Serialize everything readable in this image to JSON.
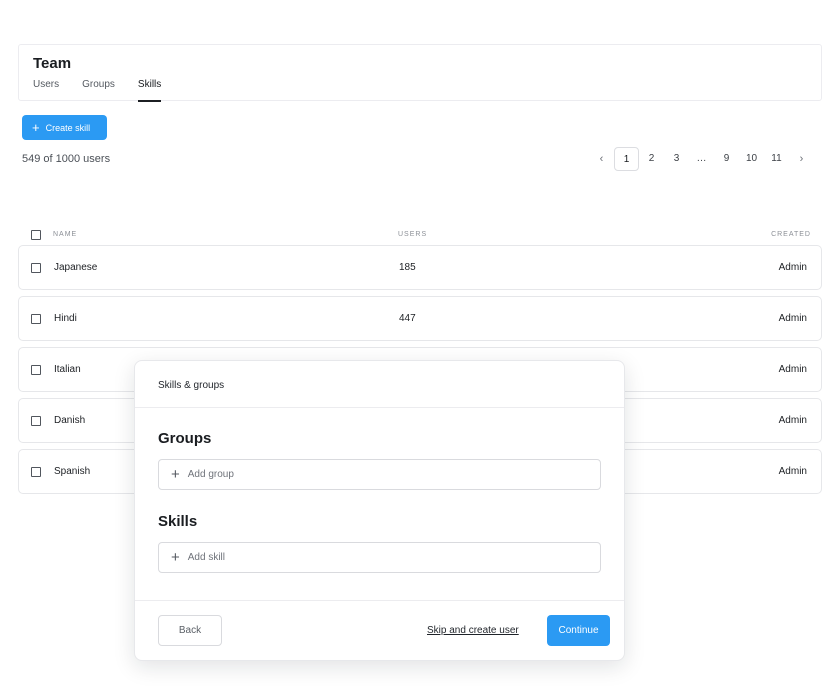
{
  "header": {
    "title": "Team",
    "tabs": [
      {
        "label": "Users"
      },
      {
        "label": "Groups"
      },
      {
        "label": "Skills"
      }
    ],
    "active_tab": "Skills"
  },
  "toolbar": {
    "create_label": "Create skill",
    "create_icon": "plus-icon"
  },
  "summary": {
    "count_text": "549 of 1000 users"
  },
  "pagination": {
    "prev": "‹",
    "next": "›",
    "pages": [
      "1",
      "2",
      "3",
      "…",
      "9",
      "10",
      "11"
    ],
    "current": "1"
  },
  "table": {
    "columns": [
      "NAME",
      "USERS",
      "CREATED"
    ],
    "rows": [
      {
        "name": "Japanese",
        "users": "185",
        "created": "Admin"
      },
      {
        "name": "Hindi",
        "users": "447",
        "created": "Admin"
      },
      {
        "name": "Italian",
        "users": "",
        "created": "Admin"
      },
      {
        "name": "Danish",
        "users": "",
        "created": "Admin"
      },
      {
        "name": "Spanish",
        "users": "",
        "created": "Admin"
      }
    ]
  },
  "modal": {
    "title": "Skills & groups",
    "groups_heading": "Groups",
    "add_group_label": "Add group",
    "skills_heading": "Skills",
    "add_skill_label": "Add skill",
    "back_label": "Back",
    "skip_label": "Skip and create user",
    "continue_label": "Continue"
  },
  "colors": {
    "accent": "#2b9af3",
    "text": "#1f2329",
    "border": "#e6e7ea"
  }
}
